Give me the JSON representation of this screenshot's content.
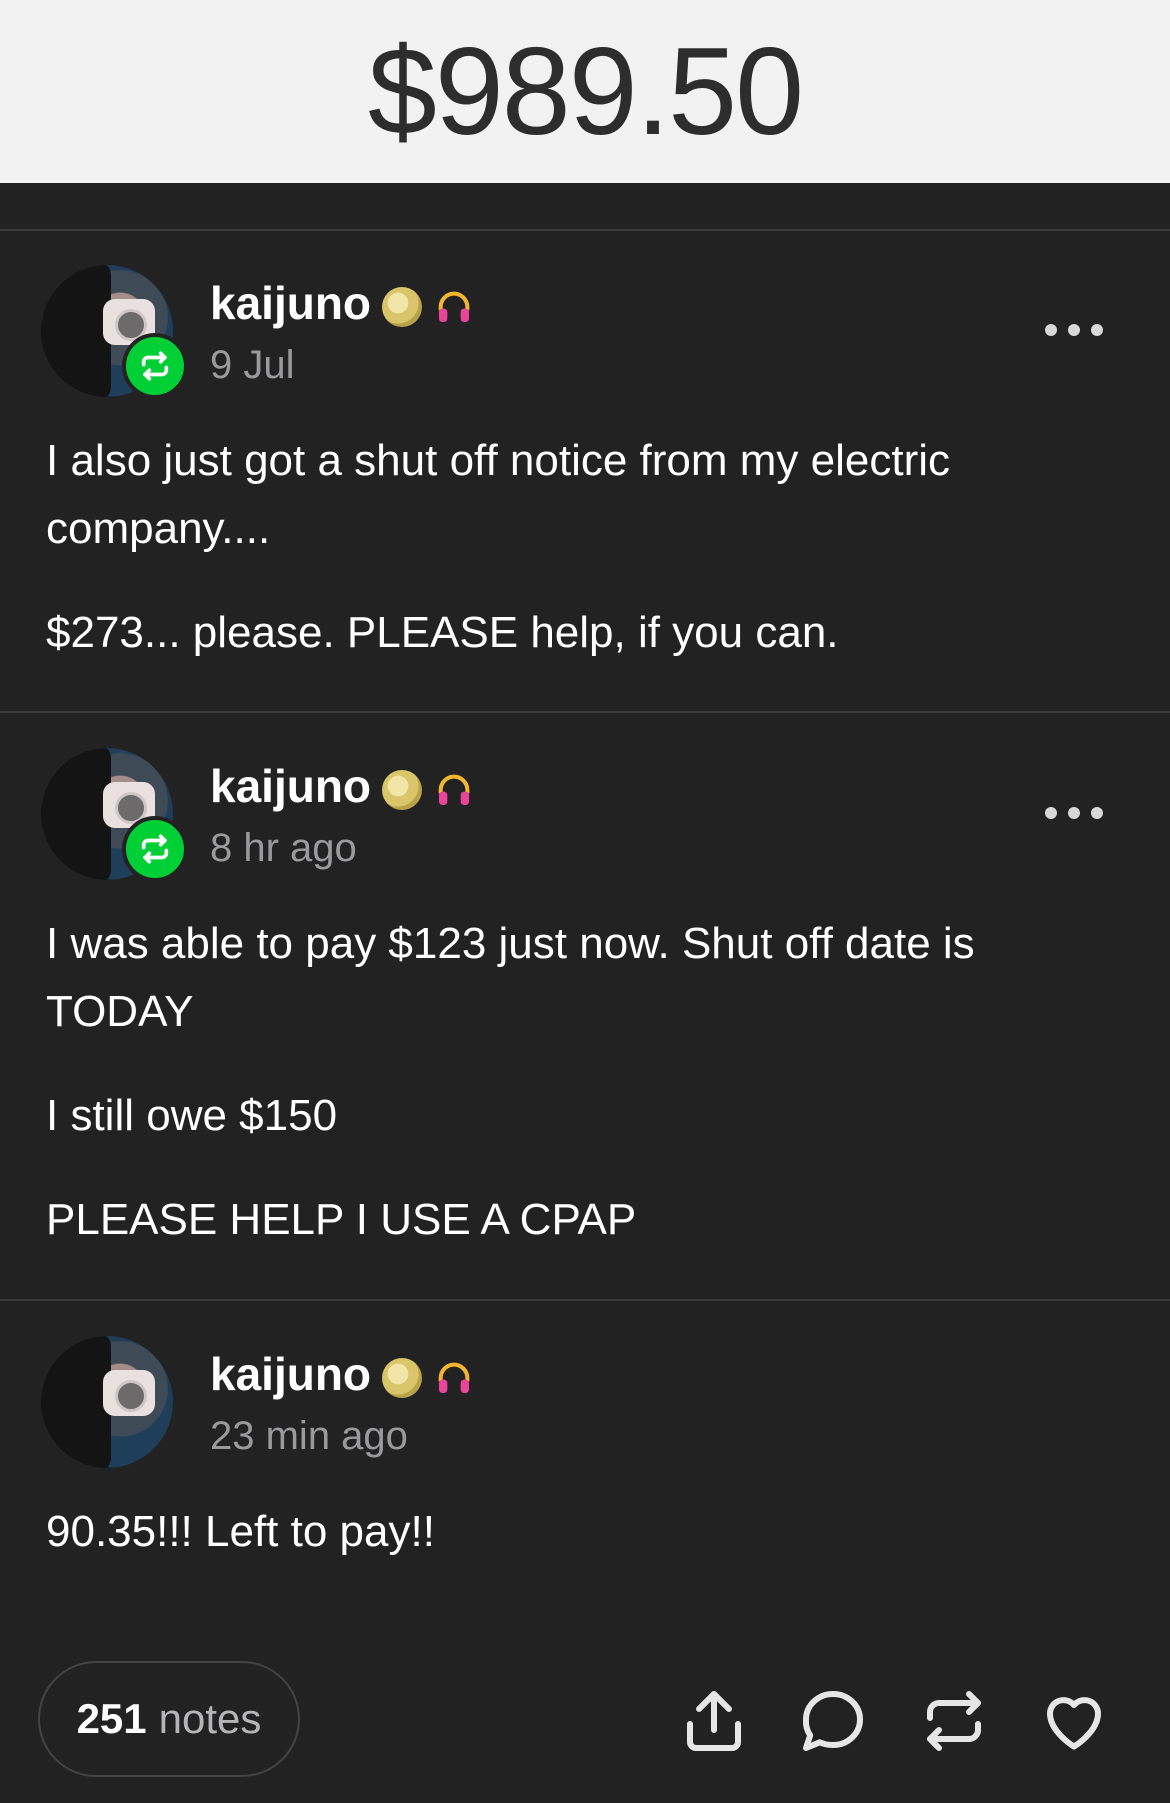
{
  "header": {
    "amount": "$989.50"
  },
  "posts": [
    {
      "username": "kaijuno",
      "timestamp": "9 Jul",
      "paragraphs": [
        "I also just got a shut off notice from my electric company....",
        "$273... please. PLEASE help, if you can."
      ]
    },
    {
      "username": "kaijuno",
      "timestamp": "8 hr ago",
      "paragraphs": [
        "I was able to pay $123 just now. Shut off date is TODAY",
        "I still owe $150",
        "PLEASE HELP I USE A CPAP"
      ]
    },
    {
      "username": "kaijuno",
      "timestamp": "23 min ago",
      "paragraphs": [
        "90.35!!! Left to pay!!"
      ]
    }
  ],
  "footer": {
    "notes_count": "251",
    "notes_label": "notes"
  },
  "colors": {
    "background": "#222223",
    "reblog_green": "#00cf35",
    "header_bg": "#f2f2f2"
  },
  "icons": [
    "reblog-icon",
    "moon-icon",
    "headphones-icon",
    "more-icon",
    "share-icon",
    "comment-icon",
    "reblog-action-icon",
    "heart-icon"
  ]
}
